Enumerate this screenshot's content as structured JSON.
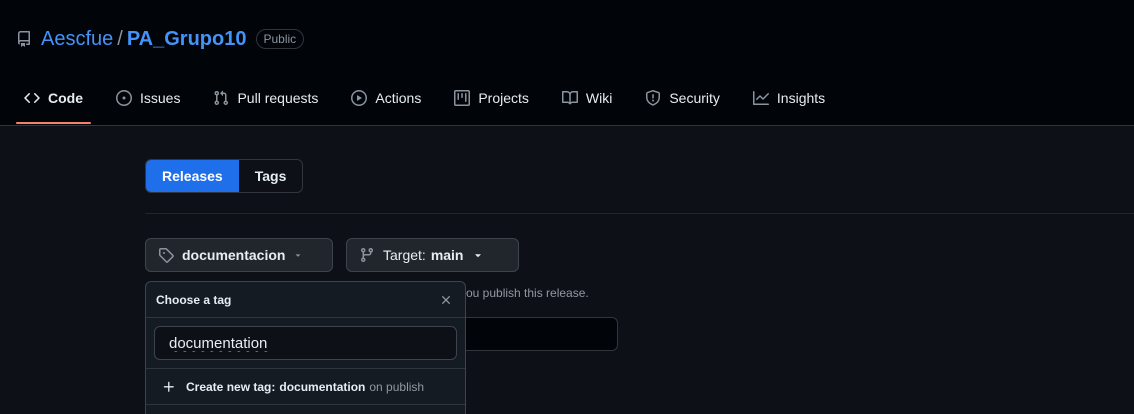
{
  "repo": {
    "owner": "Aescfue",
    "separator": "/",
    "name": "PA_Grupo10",
    "visibility": "Public"
  },
  "tabs": [
    {
      "label": "Code",
      "icon": "code-icon",
      "active": true
    },
    {
      "label": "Issues",
      "icon": "issue-icon"
    },
    {
      "label": "Pull requests",
      "icon": "pull-request-icon"
    },
    {
      "label": "Actions",
      "icon": "play-icon"
    },
    {
      "label": "Projects",
      "icon": "project-table-icon"
    },
    {
      "label": "Wiki",
      "icon": "book-icon"
    },
    {
      "label": "Security",
      "icon": "shield-icon"
    },
    {
      "label": "Insights",
      "icon": "graph-icon"
    }
  ],
  "segmented": {
    "releases": "Releases",
    "tags": "Tags",
    "selected": "Releases"
  },
  "tag_picker": {
    "label": "documentacion",
    "icon": "tag-icon"
  },
  "target": {
    "label": "Target:",
    "value": "main",
    "icon": "branch-icon"
  },
  "helper_text": "ou publish this release.",
  "popover": {
    "title": "Choose a tag",
    "filter_value": "documentation",
    "create_prefix": "Create new tag:",
    "create_tag": "documentation",
    "create_suffix": "on publish"
  },
  "colors": {
    "accent": "#1f6feb",
    "link": "#4493f8",
    "tab_underline": "#f78166"
  }
}
